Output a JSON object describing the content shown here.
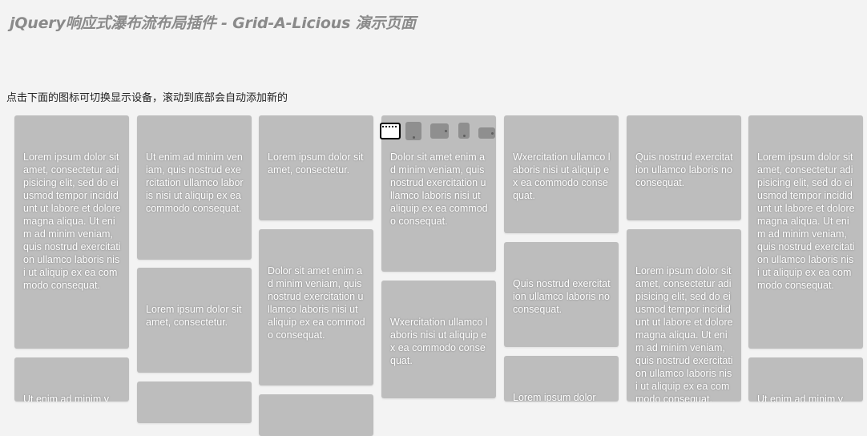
{
  "header": {
    "title": "jQuery响应式瀑布流布局插件 - Grid-A-Licious 演示页面",
    "hint": "点击下面的图标可切换显示设备，滚动到底部会自动添加新的"
  },
  "device_switcher": [
    {
      "icon": "desktop-icon",
      "selected": true
    },
    {
      "icon": "tablet-portrait-icon",
      "selected": false
    },
    {
      "icon": "tablet-landscape-icon",
      "selected": false
    },
    {
      "icon": "phone-portrait-icon",
      "selected": false
    },
    {
      "icon": "phone-landscape-icon",
      "selected": false
    }
  ],
  "cards": [
    "Lorem ipsum dolor sit amet, consectetur adipisicing elit, sed do eiusmod tempor incididunt ut labore et dolore magna aliqua. Ut enim ad minim veniam, quis nostrud exercitation ullamco laboris nisi ut aliquip ex ea commodo consequat.",
    "Ut enim ad minim veniam, quis nostrud exercitation ullamco laboris nisi ut aliquip ex ea commodo consequat.",
    "Lorem ipsum dolor sit amet, consectetur.",
    "Dolor sit amet enim ad minim veniam, quis nostrud exercitation ullamco laboris nisi ut aliquip ex ea commodo consequat.",
    "Wxercitation ullamco laboris nisi ut aliquip ex ea commodo consequat.",
    "Quis nostrud exercitation ullamco laboris no consequat.",
    "Lorem ipsum dolor sit amet, consectetur adipisicing elit, sed do eiusmod tempor incididunt ut labore et dolore magna aliqua. Ut enim ad minim veniam, quis nostrud exercitation ullamco laboris nisi ut aliquip ex ea commodo consequat.",
    "Lorem ipsum dolor sit amet, consectetur.",
    "Dolor sit amet enim ad minim veniam, quis nostrud exercitation ullamco laboris nisi ut aliquip ex ea commodo consequat.",
    "Wxercitation ullamco laboris nisi ut aliquip ex ea commodo consequat.",
    "Quis nostrud exercitation ullamco laboris no consequat.",
    "Lorem ipsum dolor sit amet, consectetur adipisicing elit, sed do eiusmod tempor incididunt ut labore et dolore magna aliqua. Ut enim ad minim veniam, quis nostrud exercitation ullamco laboris nisi ut aliquip ex ea commodo consequat.",
    "Ut enim ad minim v",
    "",
    "",
    "Lorem ipsum dolor",
    "Ut enim ad minim v"
  ]
}
